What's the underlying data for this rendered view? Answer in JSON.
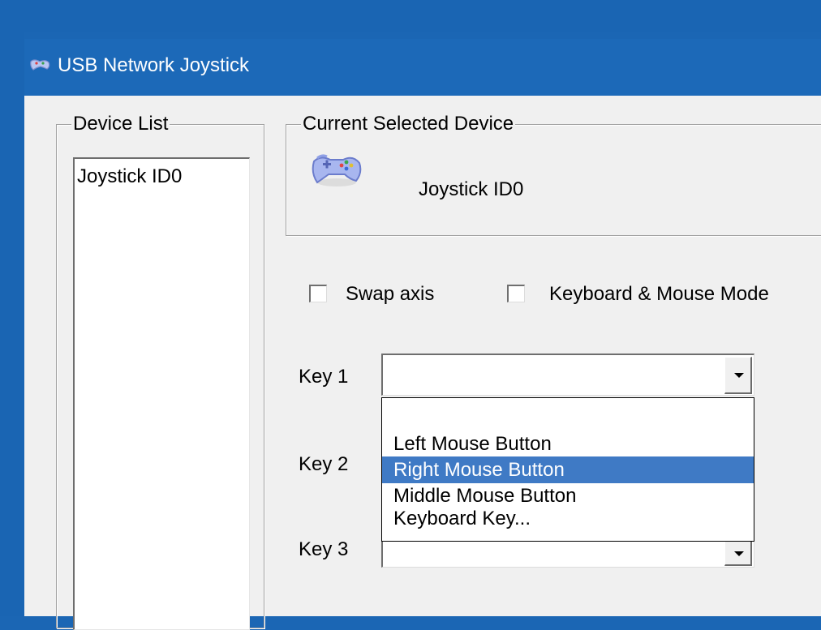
{
  "window": {
    "title": "USB Network Joystick"
  },
  "device_list": {
    "label": "Device List",
    "items": [
      "Joystick ID0"
    ]
  },
  "current_device": {
    "label": "Current Selected Device",
    "name": "Joystick ID0"
  },
  "options": {
    "swap_axis": {
      "label": "Swap axis",
      "checked": false
    },
    "keyboard_mouse_mode": {
      "label": "Keyboard & Mouse Mode",
      "checked": false
    }
  },
  "keys": [
    {
      "label": "Key 1",
      "value": ""
    },
    {
      "label": "Key 2",
      "value": ""
    },
    {
      "label": "Key 3",
      "value": ""
    }
  ],
  "dropdown": {
    "open_for": "Key 1",
    "items": [
      "",
      "Left Mouse Button",
      "Right Mouse Button",
      "Middle Mouse Button",
      "Keyboard Key..."
    ],
    "highlighted": "Right Mouse Button"
  },
  "colors": {
    "desktop": "#1b66b4",
    "titlebar": "#1c69b8",
    "highlight": "#3f7ac5",
    "window": "#f0f0f0"
  }
}
